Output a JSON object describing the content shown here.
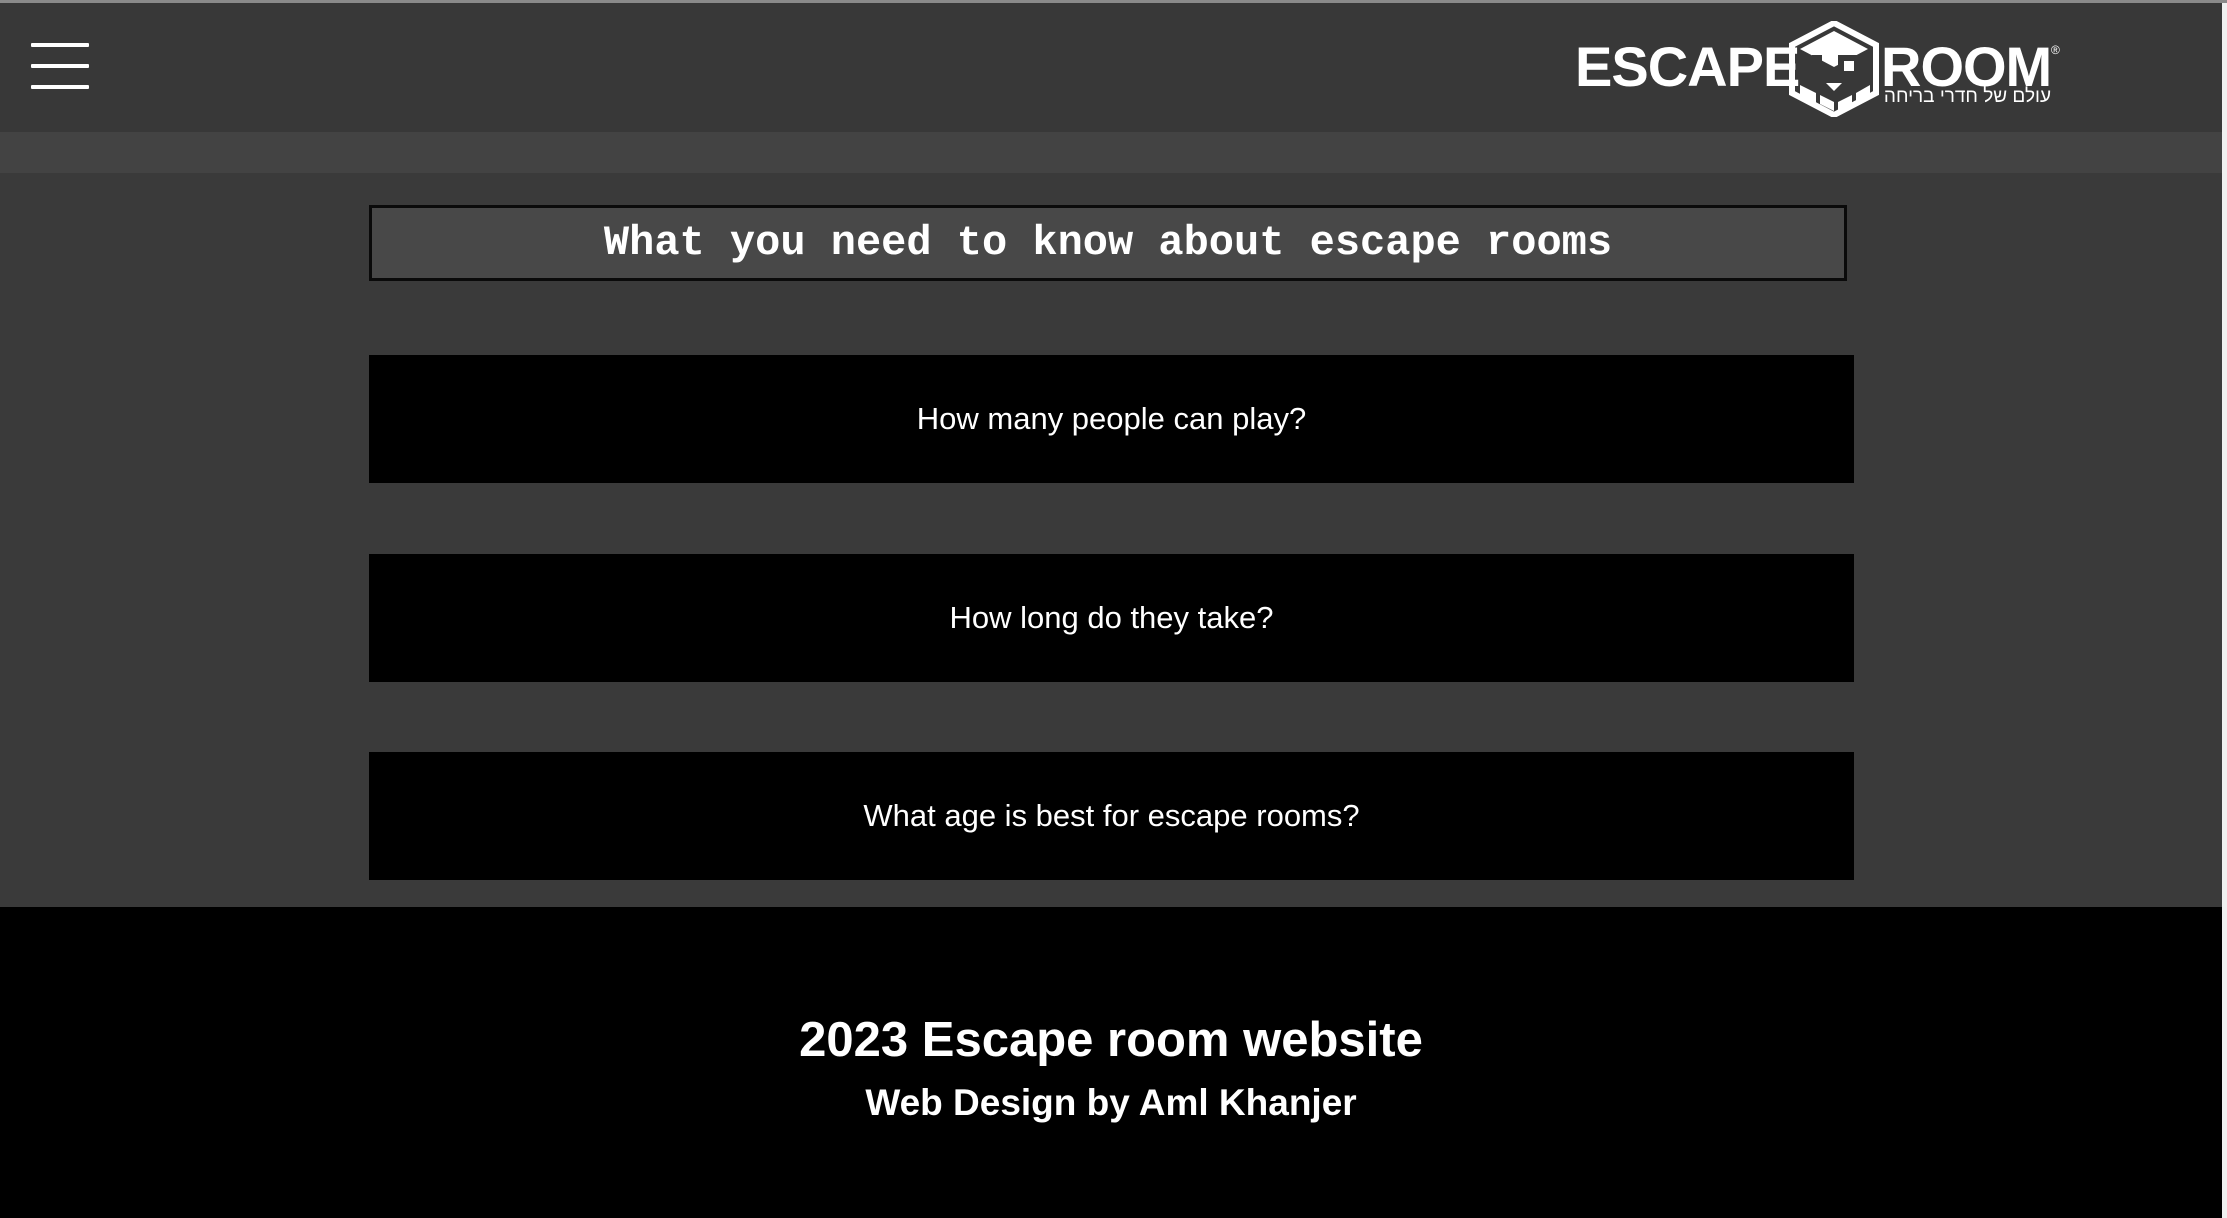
{
  "header": {
    "menu_icon": "hamburger-menu-icon",
    "logo": {
      "word_left": "ESCAPE",
      "word_right": "ROOM",
      "subtitle": "עולם של חדרי בריחה",
      "registered": "®"
    }
  },
  "main": {
    "title": "What you need to know about escape rooms",
    "faq": [
      {
        "question": "How many people can play?"
      },
      {
        "question": "How long do they take?"
      },
      {
        "question": "What age is best for escape rooms?"
      }
    ]
  },
  "footer": {
    "title": "2023 Escape room website",
    "credit": "Web Design by Aml Khanjer"
  },
  "colors": {
    "background": "#3a3a3a",
    "faq_background": "#000000",
    "footer_background": "#000000",
    "text": "#ffffff"
  }
}
